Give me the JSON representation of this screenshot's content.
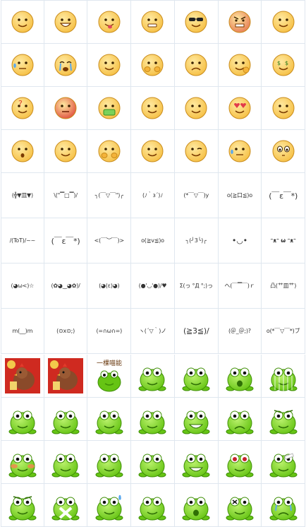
{
  "colors": {
    "grid_line": "#dfe7ef",
    "face_skin": "#f6c24a",
    "face_edge": "#c98b1a",
    "frog_green": "#66c414",
    "frog_dark": "#3f8f06",
    "accent_red": "#d93a2a"
  },
  "face_emoticons": [
    {
      "icon": "smile-face-icon",
      "expr": "smile"
    },
    {
      "icon": "grin-face-icon",
      "expr": "grin"
    },
    {
      "icon": "tongue-face-icon",
      "expr": "tongue"
    },
    {
      "icon": "grimace-face-icon",
      "expr": "grimace"
    },
    {
      "icon": "sunglasses-face-icon",
      "expr": "cool"
    },
    {
      "icon": "angry-face-icon",
      "expr": "angry"
    },
    {
      "icon": "smirk-face-icon",
      "expr": "smirk"
    },
    {
      "icon": "sweat-face-icon",
      "expr": "sweat"
    },
    {
      "icon": "crying-face-icon",
      "expr": "cry"
    },
    {
      "icon": "headache-face-icon",
      "expr": "annoyed"
    },
    {
      "icon": "cover-mouth-face-icon",
      "expr": "hands"
    },
    {
      "icon": "frown-face-icon",
      "expr": "frown"
    },
    {
      "icon": "fist-face-icon",
      "expr": "fist"
    },
    {
      "icon": "money-face-icon",
      "expr": "money"
    },
    {
      "icon": "question-face-icon",
      "expr": "question"
    },
    {
      "icon": "red-angry-face-icon",
      "expr": "red"
    },
    {
      "icon": "vomit-face-icon",
      "expr": "vomit"
    },
    {
      "icon": "thinking-face-icon",
      "expr": "thinking"
    },
    {
      "icon": "shy-face-icon",
      "expr": "shy"
    },
    {
      "icon": "heart-eyes-face-icon",
      "expr": "love"
    },
    {
      "icon": "calm-face-icon",
      "expr": "calm"
    },
    {
      "icon": "scared-face-icon",
      "expr": "scared"
    },
    {
      "icon": "sly-face-icon",
      "expr": "sly"
    },
    {
      "icon": "hands-face-icon",
      "expr": "hands2"
    },
    {
      "icon": "happy-face-icon",
      "expr": "happy"
    },
    {
      "icon": "wink-face-icon",
      "expr": "wink"
    },
    {
      "icon": "sweat-blue-face-icon",
      "expr": "sweat2"
    },
    {
      "icon": "big-eyes-face-icon",
      "expr": "bigeyes"
    }
  ],
  "text_emoticons": [
    {
      "text": "(╬▼皿▼)",
      "size": "normal"
    },
    {
      "text": "\\(\"▔□▔)/",
      "size": "normal"
    },
    {
      "text": "╮(￣▽￣\")╭",
      "size": "normal"
    },
    {
      "text": "(ﾉ｀з´)ﾉ",
      "size": "normal"
    },
    {
      "text": "(*￣▽￣)y",
      "size": "normal"
    },
    {
      "text": "o(≧口≦)o",
      "size": "normal"
    },
    {
      "text": "(￣ε￣*)",
      "size": "big"
    },
    {
      "text": "/(ToT)/~~",
      "size": "normal"
    },
    {
      "text": "(￣ε￣*)",
      "size": "big"
    },
    {
      "text": "<(￣︶￣)>",
      "size": "normal"
    },
    {
      "text": "o(≧v≦)o",
      "size": "normal"
    },
    {
      "text": "╮(╯3╰)╭",
      "size": "normal"
    },
    {
      "text": "•◡•",
      "size": "big"
    },
    {
      "text": "ᵔᴥᵔ ω ᵔᴥᵔ",
      "size": "bold"
    },
    {
      "text": "(◕ω<)☆",
      "size": "normal"
    },
    {
      "text": "(✿◕‿◕✿)/",
      "size": "normal"
    },
    {
      "text": "(◕(ε)◕)",
      "size": "normal"
    },
    {
      "text": "(●'◡'●)/♥",
      "size": "normal"
    },
    {
      "text": "Σ(っ °Д °;)っ",
      "size": "normal"
    },
    {
      "text": "ヘ(￣▔￣)ｒ",
      "size": "normal"
    },
    {
      "text": "凸(艹皿艹)",
      "size": "normal"
    },
    {
      "text": "m(__)m",
      "size": "normal"
    },
    {
      "text": "(⊙x⊙;)",
      "size": "normal"
    },
    {
      "text": "(=∩ω∩=)",
      "size": "normal"
    },
    {
      "text": "ヽ(´▽｀)ノ",
      "size": "normal"
    },
    {
      "text": "(≧3≦)/",
      "size": "big"
    },
    {
      "text": "(＠_＠;)?",
      "size": "normal"
    },
    {
      "text": "o(*￣▽￣*)ブ",
      "size": "normal"
    }
  ],
  "frog_stickers": [
    {
      "icon": "rooster-lunar-sticker-icon",
      "kind": "rooster"
    },
    {
      "icon": "rooster-red-sticker-icon",
      "kind": "rooster"
    },
    {
      "icon": "frog-sign-sticker-icon",
      "kind": "sign",
      "sign_text": "一棵喵能"
    },
    {
      "icon": "frog-leap-sticker-icon",
      "kind": "frog",
      "mood": "leap"
    },
    {
      "icon": "frog-shy-sticker-icon",
      "kind": "frog",
      "mood": "shy"
    },
    {
      "icon": "frog-surprised-sticker-icon",
      "kind": "frog",
      "mood": "surprised"
    },
    {
      "icon": "frog-striped-sticker-icon",
      "kind": "frog",
      "mood": "striped"
    },
    {
      "icon": "frog-fight-sticker-icon",
      "kind": "frog",
      "mood": "fight"
    },
    {
      "icon": "frog-sit-sticker-icon",
      "kind": "frog",
      "mood": "sit"
    },
    {
      "icon": "frog-think-sticker-icon",
      "kind": "frog",
      "mood": "think"
    },
    {
      "icon": "frog-smile-sticker-icon",
      "kind": "frog",
      "mood": "smile"
    },
    {
      "icon": "frog-grin-sticker-icon",
      "kind": "frog",
      "mood": "grin"
    },
    {
      "icon": "frog-sad-sticker-icon",
      "kind": "frog",
      "mood": "sad"
    },
    {
      "icon": "frog-angry-sticker-icon",
      "kind": "frog",
      "mood": "angry"
    },
    {
      "icon": "frog-blush-sticker-icon",
      "kind": "frog",
      "mood": "blush"
    },
    {
      "icon": "frog-happy-sticker-icon",
      "kind": "frog",
      "mood": "happy"
    },
    {
      "icon": "frog-round-sticker-icon",
      "kind": "frog",
      "mood": "round"
    },
    {
      "icon": "frog-wave-sticker-icon",
      "kind": "frog",
      "mood": "wave"
    },
    {
      "icon": "frog-teeth-sticker-icon",
      "kind": "frog",
      "mood": "teeth"
    },
    {
      "icon": "frog-red-eyes-sticker-icon",
      "kind": "frog",
      "mood": "redeyes"
    },
    {
      "icon": "frog-hurt-sticker-icon",
      "kind": "frog",
      "mood": "hurt"
    },
    {
      "icon": "frog-mad-sticker-icon",
      "kind": "frog",
      "mood": "mad"
    },
    {
      "icon": "frog-cross-sticker-icon",
      "kind": "frog",
      "mood": "cross"
    },
    {
      "icon": "frog-sweat-sticker-icon",
      "kind": "frog",
      "mood": "sweat"
    },
    {
      "icon": "frog-dance-sticker-icon",
      "kind": "frog",
      "mood": "dance"
    },
    {
      "icon": "frog-shout-sticker-icon",
      "kind": "frog",
      "mood": "shout"
    },
    {
      "icon": "frog-dizzy-sticker-icon",
      "kind": "frog",
      "mood": "dizzy"
    },
    {
      "icon": "frog-cry-sticker-icon",
      "kind": "frog",
      "mood": "cry"
    }
  ]
}
